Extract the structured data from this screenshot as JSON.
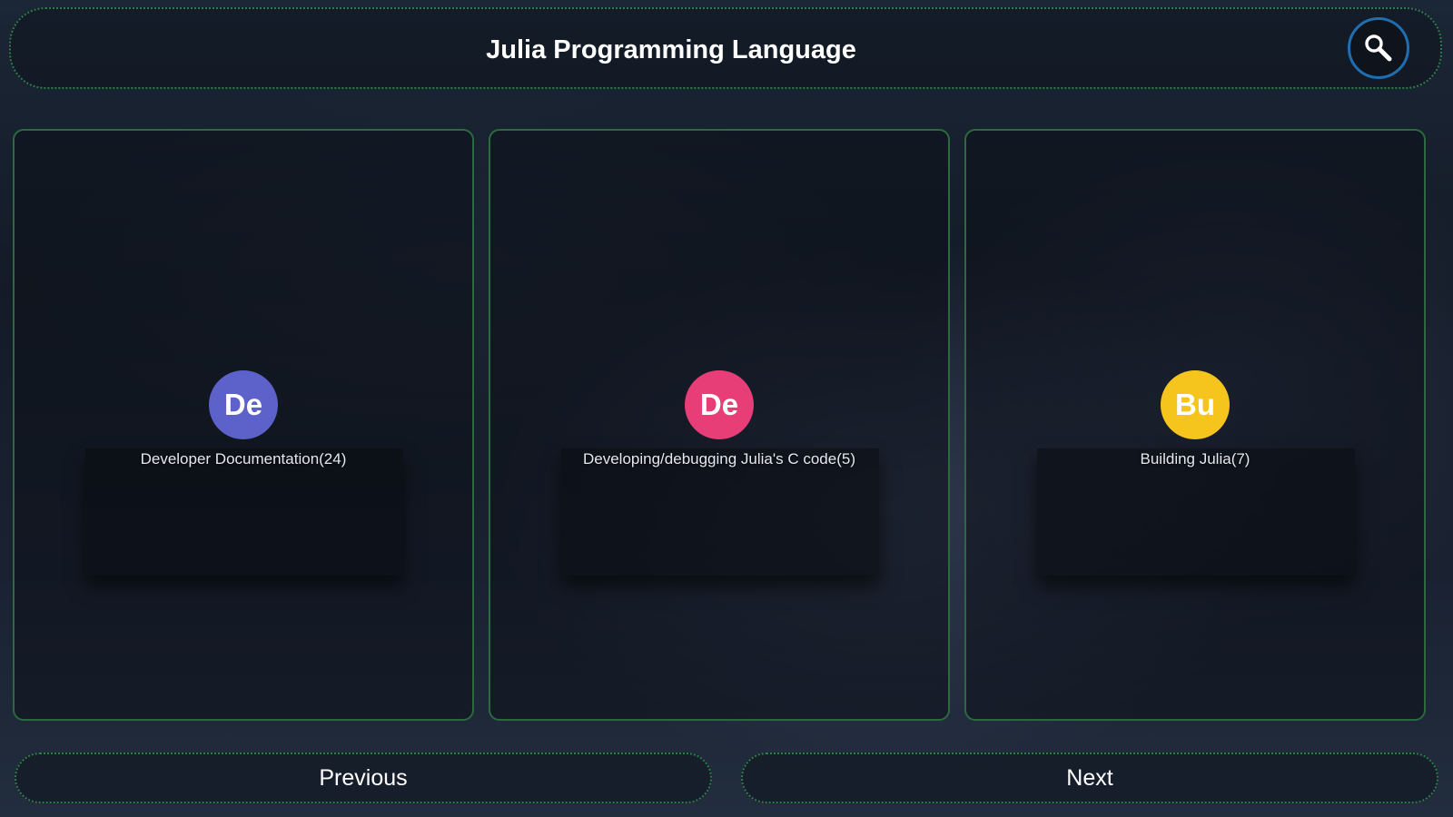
{
  "header": {
    "title": "Julia Programming Language",
    "search_icon": "search-icon"
  },
  "categories": [
    {
      "initials": "De",
      "label": "Developer Documentation(24)",
      "color": "#5c62c9"
    },
    {
      "initials": "De",
      "label": "Developing/debugging Julia's C code(5)",
      "color": "#e83e78"
    },
    {
      "initials": "Bu",
      "label": "Building Julia(7)",
      "color": "#f5c51d"
    }
  ],
  "nav": {
    "previous_label": "Previous",
    "next_label": "Next"
  },
  "colors": {
    "border_green": "#2e7d4a",
    "search_ring": "#1f6fb0"
  }
}
